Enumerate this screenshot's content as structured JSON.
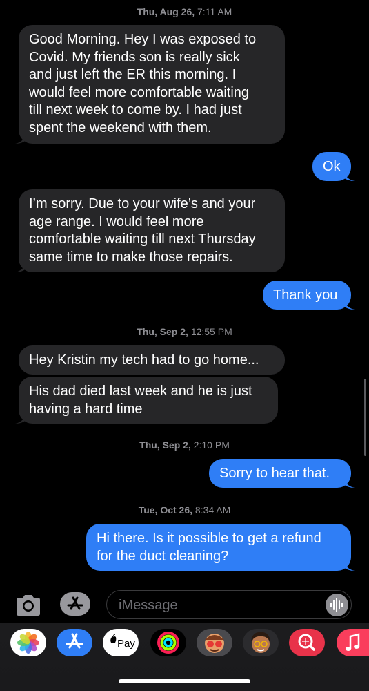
{
  "thread": {
    "timestamps": [
      {
        "day": "Thu, Aug 26,",
        "time": "7:11 AM"
      },
      {
        "day": "Thu, Sep 2,",
        "time": "12:55 PM"
      },
      {
        "day": "Thu, Sep 2,",
        "time": "2:10 PM"
      },
      {
        "day": "Tue, Oct 26,",
        "time": "8:34 AM"
      }
    ],
    "messages": [
      {
        "direction": "incoming",
        "lines": [
          "Good Morning.  Hey I was exposed to",
          "Covid.  My friends son is really sick",
          "and just left the ER this morning.   I",
          "would feel more comfortable waiting",
          "till next week to come by.  I had just",
          "spent the weekend with them."
        ]
      },
      {
        "direction": "outgoing",
        "lines": [
          "Ok"
        ]
      },
      {
        "direction": "incoming",
        "lines": [
          "I’m sorry.  Due to your wife’s and your",
          "age range.  I would feel more",
          "comfortable waiting till next Thursday",
          "same time to make those repairs."
        ]
      },
      {
        "direction": "outgoing",
        "lines": [
          "Thank you"
        ]
      },
      {
        "direction": "incoming",
        "lines": [
          "Hey Kristin my tech had to go home..."
        ]
      },
      {
        "direction": "incoming",
        "lines": [
          "His dad died last week and he is just",
          "having a hard time"
        ]
      },
      {
        "direction": "outgoing",
        "lines": [
          "Sorry to hear that."
        ]
      },
      {
        "direction": "outgoing",
        "lines": [
          "Hi there. Is it possible to get a refund",
          "for the duct cleaning?"
        ]
      }
    ]
  },
  "composer": {
    "placeholder": "iMessage",
    "camera_icon": "camera-icon",
    "apps_icon": "app-store-icon",
    "audio_icon": "waveform-icon"
  },
  "app_strip": {
    "apps": [
      {
        "name": "photos-app-icon"
      },
      {
        "name": "app-store-app-icon"
      },
      {
        "name": "apple-pay-app-icon",
        "label": "Pay"
      },
      {
        "name": "activity-app-icon"
      },
      {
        "name": "animoji-app-icon"
      },
      {
        "name": "memoji-app-icon"
      },
      {
        "name": "image-search-app-icon"
      },
      {
        "name": "music-app-icon"
      }
    ]
  },
  "colors": {
    "background": "#000000",
    "incoming_bubble": "#262628",
    "outgoing_bubble": "#2f7ef6",
    "timestamp": "#8e8e93"
  }
}
